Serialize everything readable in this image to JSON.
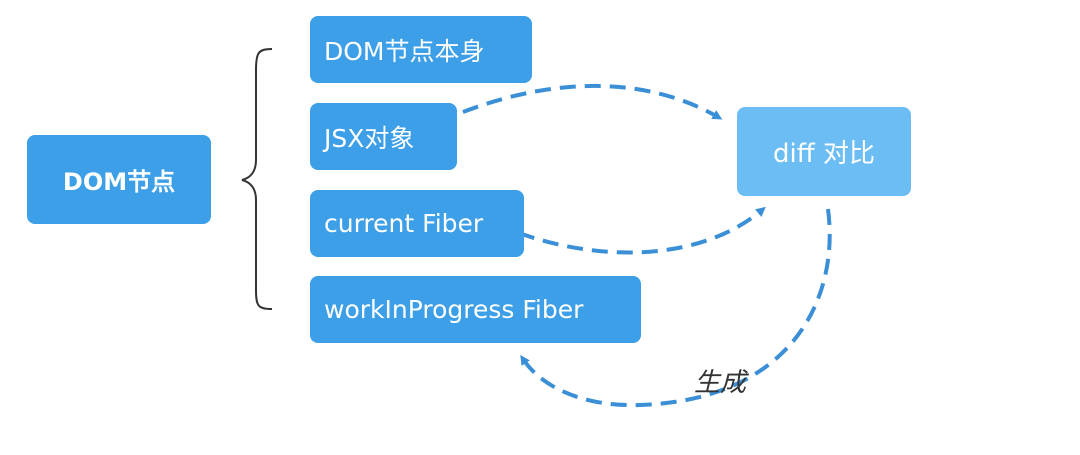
{
  "root": {
    "label": "DOM节点"
  },
  "children": [
    {
      "label": "DOM节点本身"
    },
    {
      "label": "JSX对象"
    },
    {
      "label": "current Fiber"
    },
    {
      "label": "workInProgress Fiber"
    }
  ],
  "target": {
    "label": "diff 对比"
  },
  "edge_label": "生成",
  "colors": {
    "node": "#3d9fe8",
    "target": "#6cbdf3",
    "arrow": "#3a8fd6",
    "brace": "#333333"
  }
}
